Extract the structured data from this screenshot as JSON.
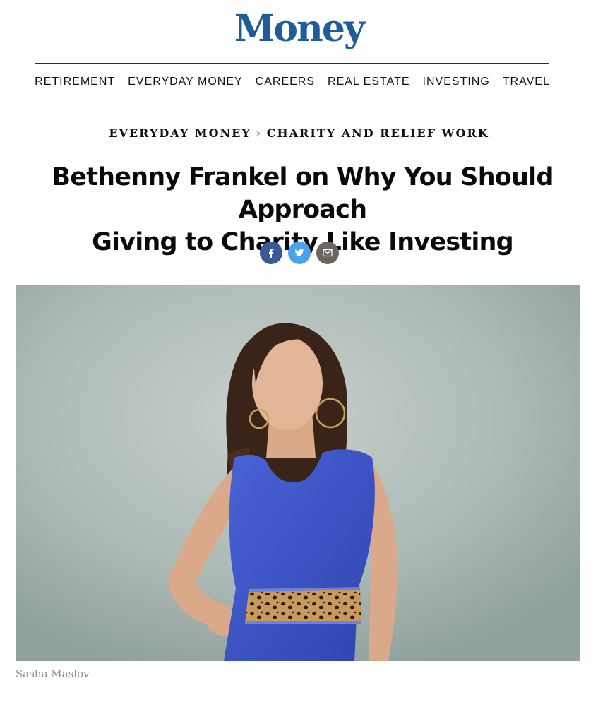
{
  "site": {
    "logo_text": "Money",
    "brand_color": "#1f5d9a"
  },
  "nav": {
    "items": [
      {
        "label": "RETIREMENT"
      },
      {
        "label": "EVERYDAY MONEY"
      },
      {
        "label": "CAREERS"
      },
      {
        "label": "REAL ESTATE"
      },
      {
        "label": "INVESTING"
      },
      {
        "label": "TRAVEL"
      }
    ]
  },
  "breadcrumb": {
    "parent": "EVERYDAY MONEY",
    "separator": "›",
    "current": "CHARITY AND RELIEF WORK"
  },
  "article": {
    "title_line1": "Bethenny Frankel on Why You Should Approach",
    "title_line2": "Giving to Charity Like Investing"
  },
  "share": {
    "facebook": {
      "icon": "facebook-icon",
      "color": "#3b5998"
    },
    "twitter": {
      "icon": "twitter-icon",
      "color": "#4aa3e8"
    },
    "email": {
      "icon": "mail-icon",
      "color": "#6b6560"
    }
  },
  "hero": {
    "credit": "Sasha Maslov",
    "dress_color": "#3d55c9",
    "background_color": "#b4c0bd"
  }
}
